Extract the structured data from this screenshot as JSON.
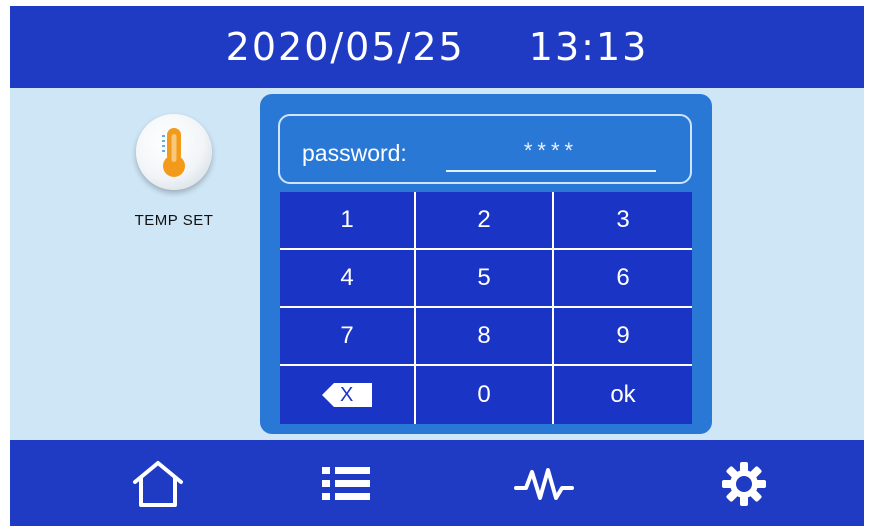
{
  "header": {
    "date": "2020/05/25",
    "time": "13:13"
  },
  "tile": {
    "label": "TEMP SET",
    "icon": "thermometer-icon"
  },
  "password": {
    "label": "password:",
    "value": "****"
  },
  "keypad": {
    "keys": [
      "1",
      "2",
      "3",
      "4",
      "5",
      "6",
      "7",
      "8",
      "9",
      "backspace",
      "0",
      "ok"
    ],
    "backspace_label": "X",
    "ok_label": "ok"
  },
  "nav": [
    "home-icon",
    "list-icon",
    "waveform-icon",
    "gear-icon"
  ],
  "colors": {
    "bar_blue": "#1f3bc4",
    "background": "#cfe6f6",
    "panel_blue": "#2a78d6",
    "key_blue": "#1a35c6",
    "thermo_orange": "#f39a1b"
  }
}
